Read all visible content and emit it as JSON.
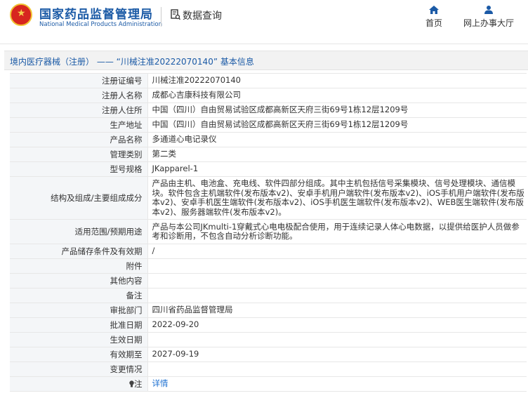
{
  "header": {
    "org_cn": "国家药品监督管理局",
    "org_en": "National Medical Products Administration",
    "query_label": "数据查询",
    "nav": [
      {
        "label": "首页",
        "icon": "home-icon"
      },
      {
        "label": "网上办事大厅",
        "icon": "user-icon"
      }
    ]
  },
  "title": "境内医疗器械（注册） ——  “川械注准20222070140” 基本信息",
  "rows": [
    {
      "key": "注册证编号",
      "value": "川械注准20222070140"
    },
    {
      "key": "注册人名称",
      "value": "成都心吉康科技有限公司"
    },
    {
      "key": "注册人住所",
      "value": "中国（四川）自由贸易试验区成都高新区天府三街69号1栋12层1209号"
    },
    {
      "key": "生产地址",
      "value": "中国（四川）自由贸易试验区成都高新区天府三街69号1栋12层1209号"
    },
    {
      "key": "产品名称",
      "value": "多通道心电记录仪"
    },
    {
      "key": "管理类别",
      "value": "第二类"
    },
    {
      "key": "型号规格",
      "value": "JKapparel-1"
    },
    {
      "key": "结构及组成/主要组成成分",
      "value": "产品由主机、电池盒、充电线、软件四部分组成。其中主机包括信号采集模块、信号处理模块、通信模块。软件包含主机端软件(发布版本v2)、安卓手机用户端软件(发布版本v2)、iOS手机用户端软件(发布版本v2)、安卓手机医生端软件(发布版本v2)、iOS手机医生端软件(发布版本v2)、WEB医生端软件(发布版本v2)、服务器端软件(发布版本v2)。"
    },
    {
      "key": "适用范围/预期用途",
      "value": "产品与本公司JKmulti-1穿戴式心电电极配合使用，用于连续记录人体心电数据，以提供给医护人员做参考和诊断用，不包含自动分析诊断功能。"
    },
    {
      "key": "产品储存条件及有效期",
      "value": "/"
    },
    {
      "key": "附件",
      "value": ""
    },
    {
      "key": "其他内容",
      "value": ""
    },
    {
      "key": "备注",
      "value": ""
    },
    {
      "key": "审批部门",
      "value": "四川省药品监督管理局"
    },
    {
      "key": "批准日期",
      "value": "2022-09-20"
    },
    {
      "key": "生效日期",
      "value": ""
    },
    {
      "key": "有效期至",
      "value": "2027-09-19"
    },
    {
      "key": "变更情况",
      "value": ""
    },
    {
      "key": "注",
      "value": "详情"
    }
  ]
}
